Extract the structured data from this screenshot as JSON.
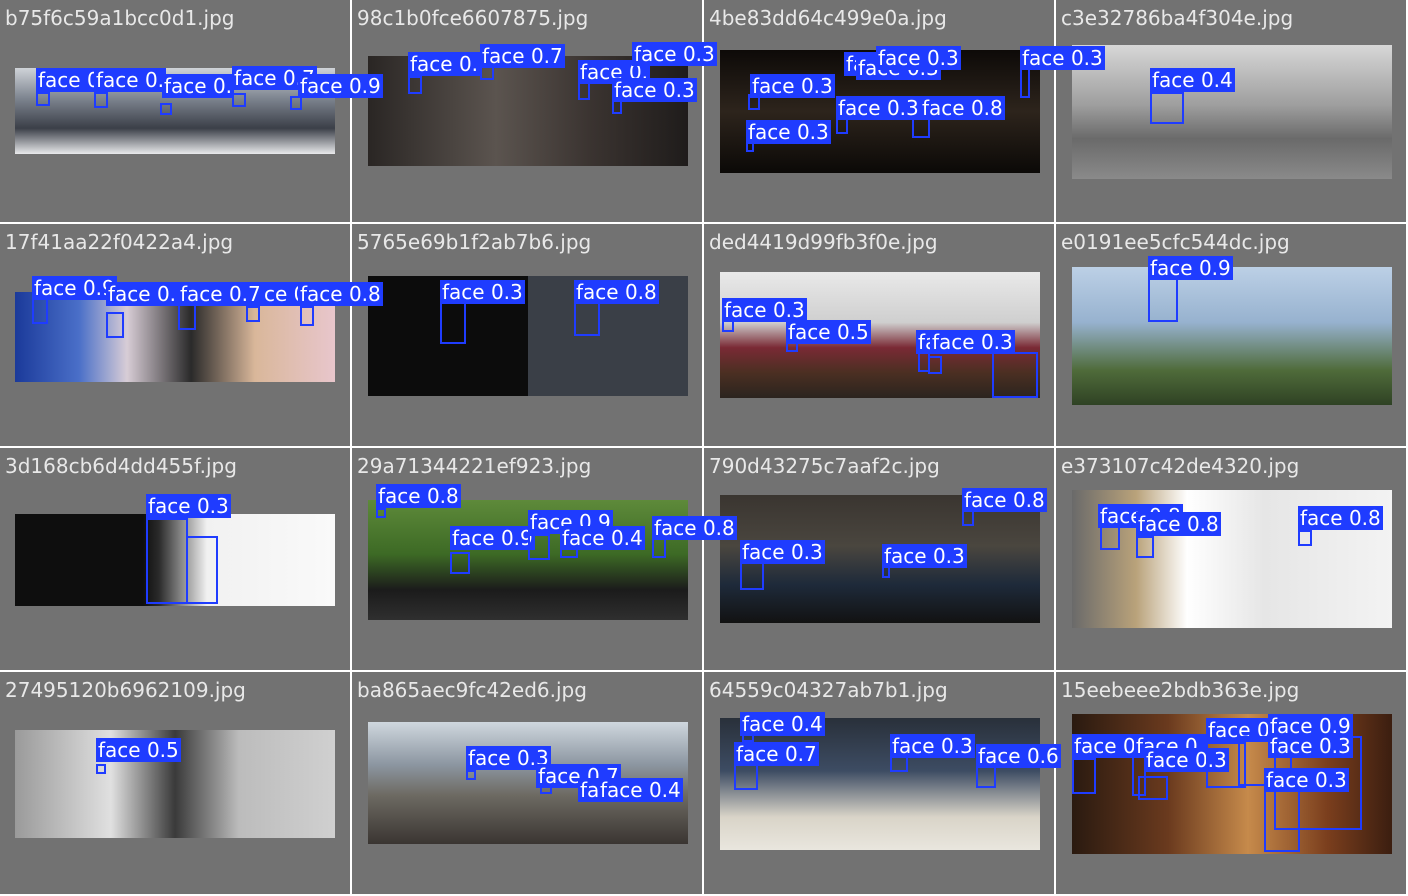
{
  "tiles": [
    {
      "file": "b75f6c59a1bcc0d1.jpg",
      "labels": [
        "face 0.",
        "face 0.",
        "face 0.",
        "face 0.7",
        "face 0.9"
      ]
    },
    {
      "file": "98c1b0fce6607875.jpg",
      "labels": [
        "face 0.",
        "face 0.7",
        "face 0.",
        "face 0.3",
        "face 0.3"
      ]
    },
    {
      "file": "4be83dd64c499e0a.jpg",
      "labels": [
        "face 0.3",
        "face 0.3",
        "face 0.3",
        "face 0.3",
        "face 0.3",
        "face 0.3",
        "face 0.8",
        "face 0.3"
      ]
    },
    {
      "file": "c3e32786ba4f304e.jpg",
      "labels": [
        "face 0.4"
      ]
    },
    {
      "file": "17f41aa22f0422a4.jpg",
      "labels": [
        "face 0.9",
        "face 0.",
        "face 0.7",
        "ce 0.",
        "face 0.8"
      ]
    },
    {
      "file": "5765e69b1f2ab7b6.jpg",
      "labels": [
        "face 0.3",
        "face 0.8"
      ]
    },
    {
      "file": "ded4419d99fb3f0e.jpg",
      "labels": [
        "face 0.3",
        "face 0.5",
        "face 0.",
        "face 0.3"
      ]
    },
    {
      "file": "e0191ee5cfc544dc.jpg",
      "labels": [
        "face 0.9"
      ]
    },
    {
      "file": "3d168cb6d4dd455f.jpg",
      "labels": [
        "face 0.3"
      ]
    },
    {
      "file": "29a71344221ef923.jpg",
      "labels": [
        "face 0.8",
        "face 0.9",
        "face 0.9",
        "face 0.4",
        "face 0.8"
      ]
    },
    {
      "file": "790d43275c7aaf2c.jpg",
      "labels": [
        "face 0.8",
        "face 0.3",
        "face 0.3"
      ]
    },
    {
      "file": "e373107c42de4320.jpg",
      "labels": [
        "face 0.8",
        "face 0.8",
        "face 0.8"
      ]
    },
    {
      "file": "27495120b6962109.jpg",
      "labels": [
        "face 0.5"
      ]
    },
    {
      "file": "ba865aec9fc42ed6.jpg",
      "labels": [
        "face 0.3",
        "face 0.7",
        "face 0.3",
        "face 0.4"
      ]
    },
    {
      "file": "64559c04327ab7b1.jpg",
      "labels": [
        "face 0.4",
        "face 0.7",
        "face 0.3",
        "face 0.6"
      ]
    },
    {
      "file": "15eebeee2bdb363e.jpg",
      "labels": [
        "face 0.",
        "face 0.",
        "face 0.3",
        "face 0.3",
        "face 0.9",
        "face 0.3",
        "face 0.3"
      ]
    }
  ],
  "colors": {
    "tile_bg": "#727272",
    "box": "#1f3cff",
    "label_text": "#ffffff",
    "filename_text": "#e8e8e8"
  }
}
